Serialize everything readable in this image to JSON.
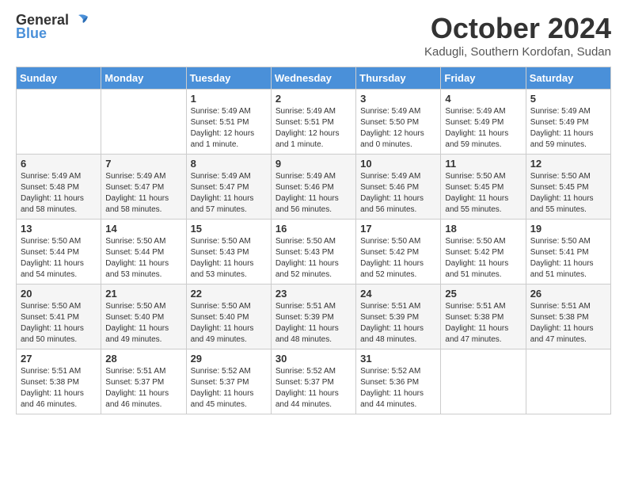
{
  "header": {
    "logo_general": "General",
    "logo_blue": "Blue",
    "month_title": "October 2024",
    "location": "Kadugli, Southern Kordofan, Sudan"
  },
  "weekdays": [
    "Sunday",
    "Monday",
    "Tuesday",
    "Wednesday",
    "Thursday",
    "Friday",
    "Saturday"
  ],
  "weeks": [
    [
      {
        "day": "",
        "info": ""
      },
      {
        "day": "",
        "info": ""
      },
      {
        "day": "1",
        "info": "Sunrise: 5:49 AM\nSunset: 5:51 PM\nDaylight: 12 hours\nand 1 minute."
      },
      {
        "day": "2",
        "info": "Sunrise: 5:49 AM\nSunset: 5:51 PM\nDaylight: 12 hours\nand 1 minute."
      },
      {
        "day": "3",
        "info": "Sunrise: 5:49 AM\nSunset: 5:50 PM\nDaylight: 12 hours\nand 0 minutes."
      },
      {
        "day": "4",
        "info": "Sunrise: 5:49 AM\nSunset: 5:49 PM\nDaylight: 11 hours\nand 59 minutes."
      },
      {
        "day": "5",
        "info": "Sunrise: 5:49 AM\nSunset: 5:49 PM\nDaylight: 11 hours\nand 59 minutes."
      }
    ],
    [
      {
        "day": "6",
        "info": "Sunrise: 5:49 AM\nSunset: 5:48 PM\nDaylight: 11 hours\nand 58 minutes."
      },
      {
        "day": "7",
        "info": "Sunrise: 5:49 AM\nSunset: 5:47 PM\nDaylight: 11 hours\nand 58 minutes."
      },
      {
        "day": "8",
        "info": "Sunrise: 5:49 AM\nSunset: 5:47 PM\nDaylight: 11 hours\nand 57 minutes."
      },
      {
        "day": "9",
        "info": "Sunrise: 5:49 AM\nSunset: 5:46 PM\nDaylight: 11 hours\nand 56 minutes."
      },
      {
        "day": "10",
        "info": "Sunrise: 5:49 AM\nSunset: 5:46 PM\nDaylight: 11 hours\nand 56 minutes."
      },
      {
        "day": "11",
        "info": "Sunrise: 5:50 AM\nSunset: 5:45 PM\nDaylight: 11 hours\nand 55 minutes."
      },
      {
        "day": "12",
        "info": "Sunrise: 5:50 AM\nSunset: 5:45 PM\nDaylight: 11 hours\nand 55 minutes."
      }
    ],
    [
      {
        "day": "13",
        "info": "Sunrise: 5:50 AM\nSunset: 5:44 PM\nDaylight: 11 hours\nand 54 minutes."
      },
      {
        "day": "14",
        "info": "Sunrise: 5:50 AM\nSunset: 5:44 PM\nDaylight: 11 hours\nand 53 minutes."
      },
      {
        "day": "15",
        "info": "Sunrise: 5:50 AM\nSunset: 5:43 PM\nDaylight: 11 hours\nand 53 minutes."
      },
      {
        "day": "16",
        "info": "Sunrise: 5:50 AM\nSunset: 5:43 PM\nDaylight: 11 hours\nand 52 minutes."
      },
      {
        "day": "17",
        "info": "Sunrise: 5:50 AM\nSunset: 5:42 PM\nDaylight: 11 hours\nand 52 minutes."
      },
      {
        "day": "18",
        "info": "Sunrise: 5:50 AM\nSunset: 5:42 PM\nDaylight: 11 hours\nand 51 minutes."
      },
      {
        "day": "19",
        "info": "Sunrise: 5:50 AM\nSunset: 5:41 PM\nDaylight: 11 hours\nand 51 minutes."
      }
    ],
    [
      {
        "day": "20",
        "info": "Sunrise: 5:50 AM\nSunset: 5:41 PM\nDaylight: 11 hours\nand 50 minutes."
      },
      {
        "day": "21",
        "info": "Sunrise: 5:50 AM\nSunset: 5:40 PM\nDaylight: 11 hours\nand 49 minutes."
      },
      {
        "day": "22",
        "info": "Sunrise: 5:50 AM\nSunset: 5:40 PM\nDaylight: 11 hours\nand 49 minutes."
      },
      {
        "day": "23",
        "info": "Sunrise: 5:51 AM\nSunset: 5:39 PM\nDaylight: 11 hours\nand 48 minutes."
      },
      {
        "day": "24",
        "info": "Sunrise: 5:51 AM\nSunset: 5:39 PM\nDaylight: 11 hours\nand 48 minutes."
      },
      {
        "day": "25",
        "info": "Sunrise: 5:51 AM\nSunset: 5:38 PM\nDaylight: 11 hours\nand 47 minutes."
      },
      {
        "day": "26",
        "info": "Sunrise: 5:51 AM\nSunset: 5:38 PM\nDaylight: 11 hours\nand 47 minutes."
      }
    ],
    [
      {
        "day": "27",
        "info": "Sunrise: 5:51 AM\nSunset: 5:38 PM\nDaylight: 11 hours\nand 46 minutes."
      },
      {
        "day": "28",
        "info": "Sunrise: 5:51 AM\nSunset: 5:37 PM\nDaylight: 11 hours\nand 46 minutes."
      },
      {
        "day": "29",
        "info": "Sunrise: 5:52 AM\nSunset: 5:37 PM\nDaylight: 11 hours\nand 45 minutes."
      },
      {
        "day": "30",
        "info": "Sunrise: 5:52 AM\nSunset: 5:37 PM\nDaylight: 11 hours\nand 44 minutes."
      },
      {
        "day": "31",
        "info": "Sunrise: 5:52 AM\nSunset: 5:36 PM\nDaylight: 11 hours\nand 44 minutes."
      },
      {
        "day": "",
        "info": ""
      },
      {
        "day": "",
        "info": ""
      }
    ]
  ]
}
